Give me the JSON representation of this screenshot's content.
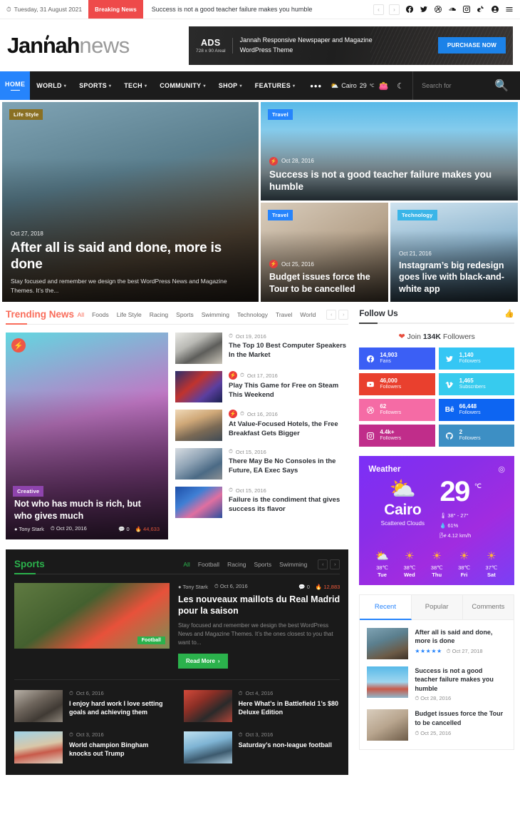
{
  "topbar": {
    "date": "Tuesday, 31 August 2021",
    "breaking_label": "Breaking News",
    "breaking_text": "Success is not a good teacher failure makes you humble",
    "prev": "‹",
    "next": "›"
  },
  "header": {
    "logo_main": "Jannah",
    "logo_light": "news",
    "ad": {
      "title": "ADS",
      "size": "728 x 90 Areal",
      "description": "Jannah Responsive Newspaper and Magazine WordPress Theme",
      "button": "PURCHASE NOW"
    }
  },
  "nav": {
    "home": "HOME",
    "items": [
      {
        "label": "WORLD",
        "caret": "▾"
      },
      {
        "label": "SPORTS",
        "caret": "▾"
      },
      {
        "label": "TECH",
        "caret": "▾"
      },
      {
        "label": "COMMUNITY",
        "caret": "▾"
      },
      {
        "label": "SHOP",
        "caret": "▾"
      },
      {
        "label": "FEATURES",
        "caret": "▾"
      }
    ],
    "more": "•••",
    "weather_city": "Cairo",
    "weather_temp": "29",
    "weather_unit": "℃",
    "search_placeholder": "Search for"
  },
  "hero": {
    "main": {
      "category": "Life Style",
      "category_color": "#8a7023",
      "date": "Oct 27, 2018",
      "title": "After all is said and done, more is done",
      "excerpt": "Stay focused and remember we design the best WordPress News and Magazine Themes. It’s the..."
    },
    "top": {
      "category": "Travel",
      "category_color": "#2684fc",
      "date": "Oct 28, 2016",
      "title": "Success is not a good teacher failure makes you humble"
    },
    "b1": {
      "category": "Travel",
      "category_color": "#2684fc",
      "date": "Oct 25, 2016",
      "title": "Budget issues force the Tour to be cancelled"
    },
    "b2": {
      "category": "Technology",
      "category_color": "#3ab5e8",
      "date": "Oct 21, 2016",
      "title": "Instagram’s big redesign goes live with black-and-white app"
    }
  },
  "trending": {
    "title": "Trending News",
    "tabs": [
      "All",
      "Foods",
      "Life Style",
      "Racing",
      "Sports",
      "Swimming",
      "Technology",
      "Travel",
      "World"
    ],
    "active_tab": "All",
    "prev": "‹",
    "next": "›",
    "feature": {
      "category": "Creative",
      "category_color": "#8e44ad",
      "title": "Not who has much is rich, but who gives much",
      "author": "Tony Stark",
      "date": "Oct 20, 2016",
      "comments": "0",
      "views": "44,633"
    },
    "items": [
      {
        "date": "Oct 19, 2016",
        "title": "The Top 10 Best Computer Speakers In the Market",
        "hot": false,
        "img": "img-speakers"
      },
      {
        "date": "Oct 17, 2016",
        "title": "Play This Game for Free on Steam This Weekend",
        "hot": true,
        "img": "img-game"
      },
      {
        "date": "Oct 16, 2016",
        "title": "At Value-Focused Hotels, the Free Breakfast Gets Bigger",
        "hot": true,
        "img": "img-hotel"
      },
      {
        "date": "Oct 15, 2016",
        "title": "There May Be No Consoles in the Future, EA Exec Says",
        "hot": false,
        "img": "img-car"
      },
      {
        "date": "Oct 15, 2016",
        "title": "Failure is the condiment that gives success its flavor",
        "hot": false,
        "img": "img-smoke"
      }
    ]
  },
  "sports": {
    "title": "Sports",
    "tabs": [
      "All",
      "Football",
      "Racing",
      "Sports",
      "Swimming"
    ],
    "active_tab": "All",
    "prev": "‹",
    "next": "›",
    "feature": {
      "tag": "Football",
      "author": "Tony Stark",
      "date": "Oct 6, 2016",
      "comments": "0",
      "views": "12,883",
      "title": "Les nouveaux maillots du Real Madrid pour la saison",
      "excerpt": "Stay focused and remember we design the best WordPress News and Magazine Themes. It’s the ones closest to you that want to...",
      "read_more": "Read More"
    },
    "items": [
      {
        "date": "Oct 6, 2016",
        "title": "I enjoy hard work I love setting goals and achieving them",
        "img": "img-gym"
      },
      {
        "date": "Oct 4, 2016",
        "title": "Here What’s in Battlefield 1’s $80 Deluxe Edition",
        "img": "img-bike"
      },
      {
        "date": "Oct 3, 2016",
        "title": "World champion Bingham knocks out Trump",
        "img": "img-beach"
      },
      {
        "date": "Oct 3, 2016",
        "title": "Saturday’s non-league football",
        "img": "img-snow"
      }
    ]
  },
  "follow": {
    "title": "Follow Us",
    "join_prefix": "Join ",
    "join_count": "134K",
    "join_suffix": " Followers",
    "networks": [
      {
        "name": "facebook",
        "count": "14,903",
        "label": "Fans",
        "color": "#3b5ff5"
      },
      {
        "name": "twitter",
        "count": "1,140",
        "label": "Followers",
        "color": "#35c6f4"
      },
      {
        "name": "youtube",
        "count": "46,000",
        "label": "Followers",
        "color": "#e9402e"
      },
      {
        "name": "vimeo",
        "count": "1,465",
        "label": "Subscribers",
        "color": "#37cbee"
      },
      {
        "name": "dribbble",
        "count": "62",
        "label": "Followers",
        "color": "#f56ba5"
      },
      {
        "name": "behance",
        "count": "66,448",
        "label": "Followers",
        "color": "#0d65f2"
      },
      {
        "name": "instagram",
        "count": "4.4k+",
        "label": "Followers",
        "color": "#c02d8a"
      },
      {
        "name": "github",
        "count": "2",
        "label": "Followers",
        "color": "#3d8fc4"
      }
    ]
  },
  "weather": {
    "title": "Weather",
    "city": "Cairo",
    "condition": "Scattered Clouds",
    "temp": "29",
    "unit": "℃",
    "high_low": "38° - 27°",
    "humidity": "61%",
    "wind": "4.12 km/h",
    "forecast": [
      {
        "temp": "38℃",
        "day": "Tue",
        "icon": "partly"
      },
      {
        "temp": "38℃",
        "day": "Wed",
        "icon": "sun"
      },
      {
        "temp": "38℃",
        "day": "Thu",
        "icon": "sun"
      },
      {
        "temp": "38℃",
        "day": "Fri",
        "icon": "sun"
      },
      {
        "temp": "37℃",
        "day": "Sat",
        "icon": "sun"
      }
    ]
  },
  "tabs_widget": {
    "tabs": [
      "Recent",
      "Popular",
      "Comments"
    ],
    "active_tab": "Recent",
    "items": [
      {
        "title": "After all is said and done, more is done",
        "date": "Oct 27, 2018",
        "stars": "★★★★★",
        "img": "img-beard"
      },
      {
        "title": "Success is not a good teacher failure makes you humble",
        "date": "Oct 28, 2016",
        "stars": "",
        "img": "img-balloon"
      },
      {
        "title": "Budget issues force the Tour to be cancelled",
        "date": "Oct 25, 2016",
        "stars": "",
        "img": "img-budget"
      }
    ]
  }
}
